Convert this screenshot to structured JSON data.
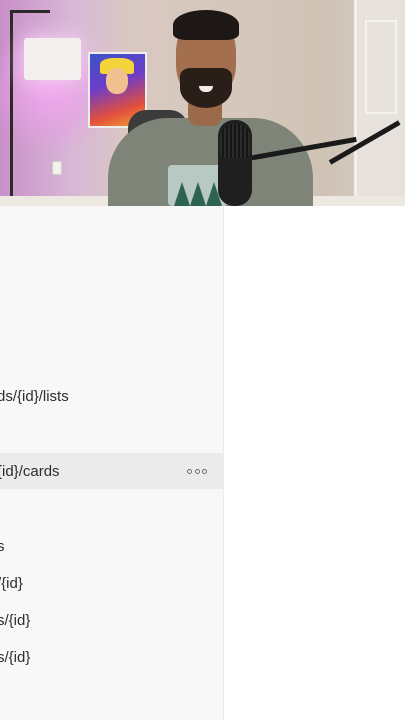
{
  "sidebar": {
    "items": [
      {
        "label": "ds/{id}/lists",
        "active": false
      },
      {
        "label": "{id}/cards",
        "active": true
      },
      {
        "label": "s",
        "active": false
      },
      {
        "label": "/{id}",
        "active": false
      },
      {
        "label": "s/{id}",
        "active": false
      },
      {
        "label": "s/{id}",
        "active": false
      }
    ],
    "more_icon": "ellipsis-horizontal-icon"
  },
  "colors": {
    "sidebar_bg": "#f8f8f8",
    "active_row_bg": "#ebebeb",
    "text": "#2d2d2d"
  }
}
